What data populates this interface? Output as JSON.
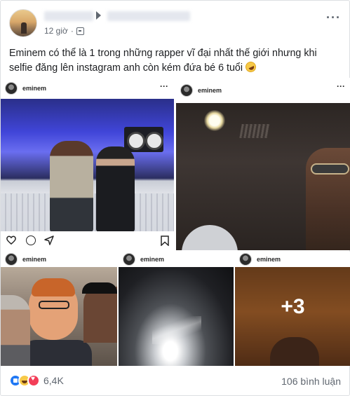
{
  "header": {
    "time": "12 giờ"
  },
  "post": {
    "text": "Eminem có thể là 1 trong những rapper vĩ đại nhất thế giới nhưng khi selfie đăng lên instagram anh còn kém đứa bé 6 tuổi"
  },
  "photos": {
    "p1": {
      "username": "eminem"
    },
    "p2": {
      "username": "eminem"
    },
    "p3": {
      "username": "eminem"
    },
    "p4": {
      "username": "eminem"
    },
    "p5": {
      "username": "eminem",
      "more": "+3"
    }
  },
  "footer": {
    "reaction_count": "6,4K",
    "comment_count": "106 bình luận"
  },
  "icons": [
    "globe-icon",
    "more-icon",
    "heart-icon",
    "comment-icon",
    "share-icon",
    "bookmark-icon",
    "like-icon",
    "haha-icon",
    "love-icon",
    "rofl-emoji-icon"
  ],
  "colors": {
    "like": "#2078f4",
    "love": "#f33e58",
    "haha": "#f7c948",
    "text_secondary": "#606770"
  }
}
